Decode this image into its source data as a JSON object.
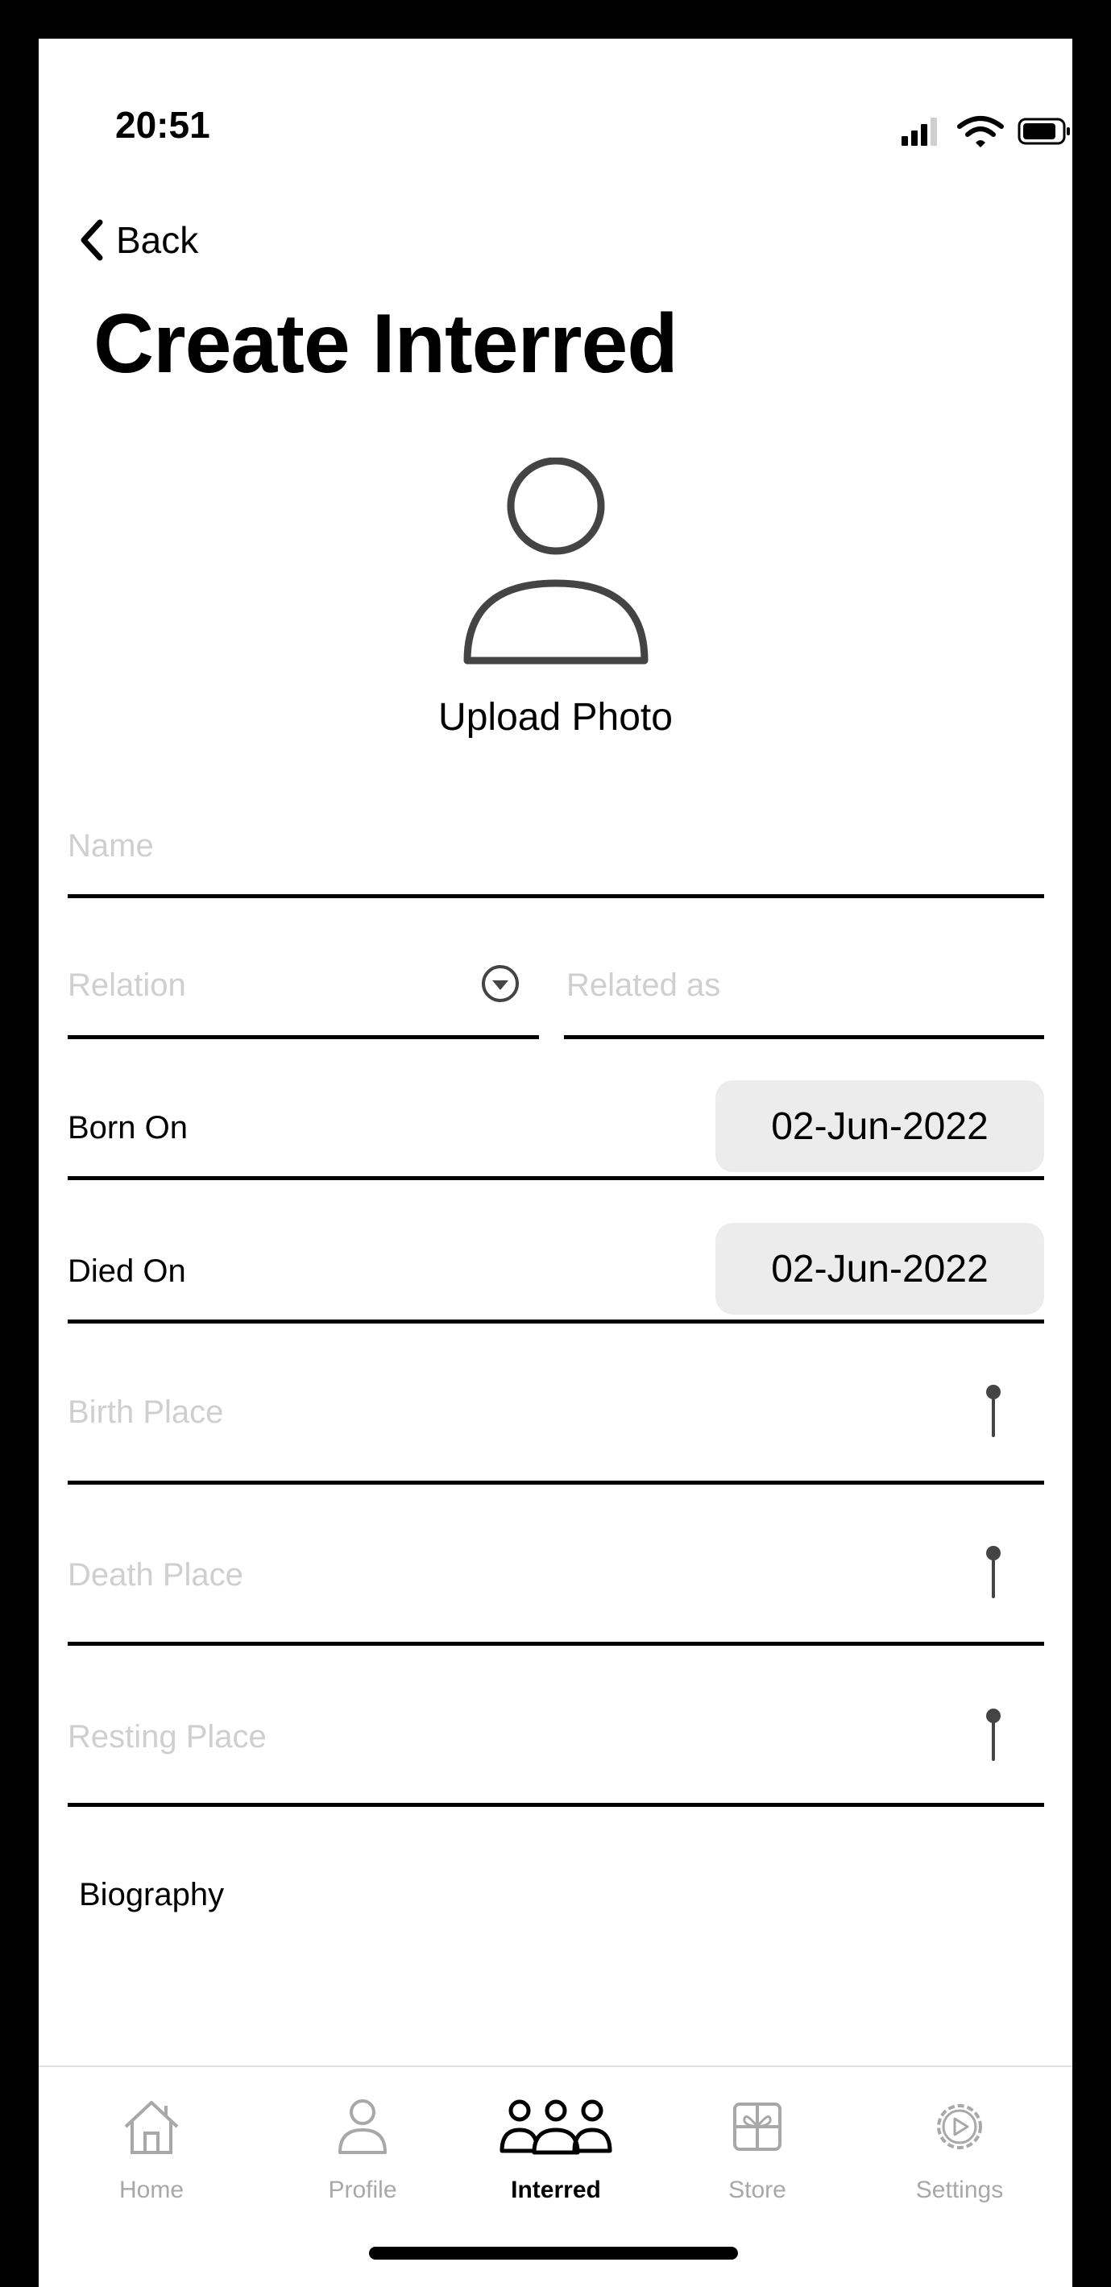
{
  "status_bar": {
    "time": "20:51"
  },
  "nav": {
    "back_label": "Back",
    "title": "Create Interred"
  },
  "photo": {
    "upload_label": "Upload Photo"
  },
  "form": {
    "name_placeholder": "Name",
    "relation_placeholder": "Relation",
    "related_as_placeholder": "Related as",
    "born_on_label": "Born On",
    "born_on_value": "02-Jun-2022",
    "died_on_label": "Died On",
    "died_on_value": "02-Jun-2022",
    "birth_place_placeholder": "Birth Place",
    "death_place_placeholder": "Death Place",
    "resting_place_placeholder": "Resting Place",
    "biography_label": "Biography"
  },
  "tabbar": {
    "items": [
      {
        "label": "Home",
        "icon": "home-icon",
        "active": false
      },
      {
        "label": "Profile",
        "icon": "person-icon",
        "active": false
      },
      {
        "label": "Interred",
        "icon": "group-icon",
        "active": true
      },
      {
        "label": "Store",
        "icon": "store-icon",
        "active": false
      },
      {
        "label": "Settings",
        "icon": "settings-icon",
        "active": false
      }
    ]
  },
  "colors": {
    "accent": "#000000",
    "placeholder": "#cfcfcf",
    "date_bg": "#ececec",
    "tab_inactive": "#a8a8a8"
  }
}
